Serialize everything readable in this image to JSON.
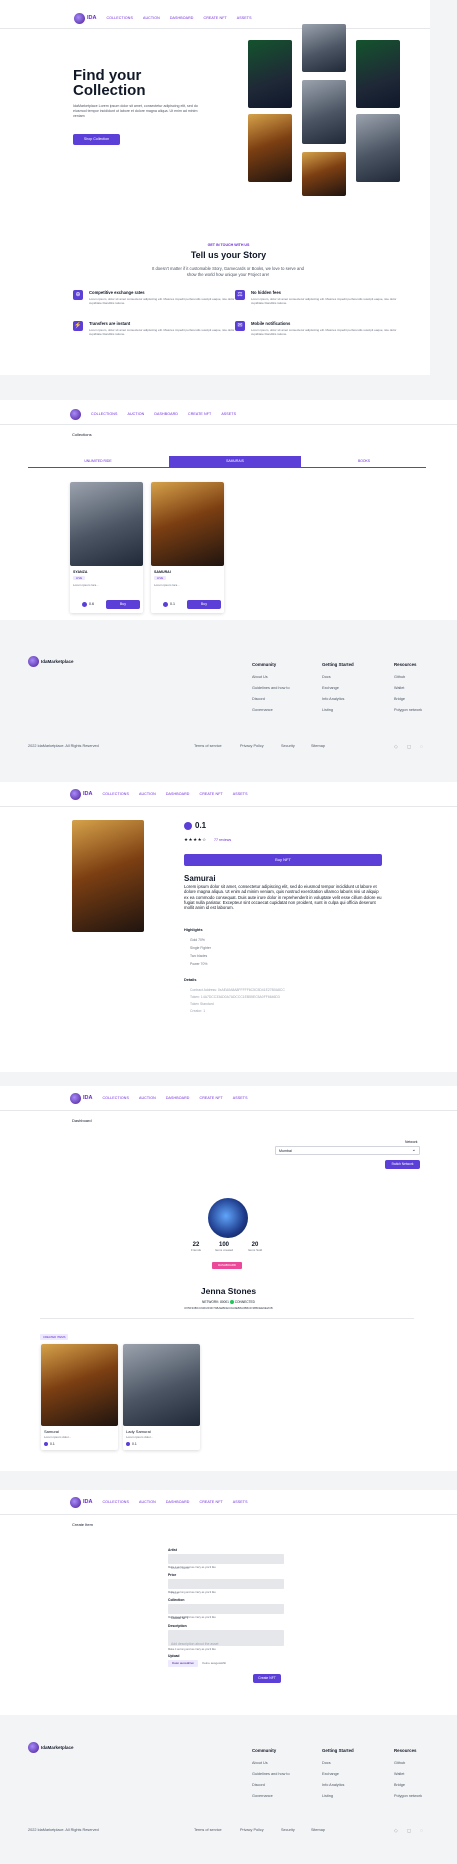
{
  "brand": {
    "logo_text": "IDA",
    "footer_name": "IdaMarketplace"
  },
  "nav": {
    "links": [
      "COLLECTIONS",
      "AUCTION",
      "DASHBOARD",
      "CREATE NFT",
      "ASSETS"
    ]
  },
  "hero": {
    "title_line1": "Find your",
    "title_line2": "Collection",
    "description": "IdaMarketplace Lorem ipsum dolor sit amet, consectetur adipiscing elit, sed do eiusmod tempor incididunt ut labore et dolore magna aliqua. Ut enim ad minim veniam",
    "button": "Shop Collection"
  },
  "story": {
    "eyebrow": "GET IN TOUCH WITH US",
    "title": "Tell us your Story",
    "subtitle": "It doesn't matter if it customable Story, Gamecards or Books, we love to serve and show the world how unique your Project are!",
    "features": [
      {
        "title": "Competitive exchange rates",
        "text": "Lorem ipsum, dolor sit amet consectetur adipisicing elit. Maiores impedit perferendis suscipit eaque, iste dolor cupiditate blanditiis ratione."
      },
      {
        "title": "No hidden fees",
        "text": "Lorem ipsum, dolor sit amet consectetur adipisicing elit. Maiores impedit perferendis suscipit eaque, iste dolor cupiditate blanditiis ratione."
      },
      {
        "title": "Transfers are instant",
        "text": "Lorem ipsum, dolor sit amet consectetur adipisicing elit. Maiores impedit perferendis suscipit eaque, iste dolor cupiditate blanditiis ratione."
      },
      {
        "title": "Mobile notifications",
        "text": "Lorem ipsum, dolor sit amet consectetur adipisicing elit. Maiores impedit perferendis suscipit eaque, iste dolor cupiditate blanditiis ratione."
      }
    ]
  },
  "collections": {
    "heading": "Collections",
    "tabs": [
      "UNLIMITED RIDE",
      "SAMURAIS",
      "BOOKS"
    ],
    "active_tab": 1,
    "cards": [
      {
        "name": "SYANZA",
        "badge": "LIVE",
        "desc": "Lorem ipsum lora...",
        "price": "0.6",
        "buy": "Buy"
      },
      {
        "name": "SAMURAI",
        "badge": "LIVE",
        "desc": "Lorem ipsum lora...",
        "price": "0.1",
        "buy": "Buy"
      }
    ]
  },
  "footer": {
    "columns": [
      {
        "title": "Community",
        "links": [
          "About Us",
          "Guidelines and how to",
          "Discord",
          "Governance"
        ]
      },
      {
        "title": "Getting Started",
        "links": [
          "Docs",
          "Exchange",
          "Info Analytics",
          "Listing"
        ]
      },
      {
        "title": "Resources",
        "links": [
          "Github",
          "Wallet",
          "Bridge",
          "Polygon network"
        ]
      }
    ],
    "copyright": "2022 IdaMarketplace. All Rights Reserved",
    "bottom_links": [
      "Terms of service",
      "Privacy Policy",
      "Security",
      "Sitemap"
    ]
  },
  "detail": {
    "price": "0.1",
    "reviews": "77 reviews",
    "buy_button": "Buy NFT",
    "title": "Samurai",
    "description": "Lorem ipsum dolor sit amet, consectetur adipiscing elit, sed do eiusmod tempor incididunt ut labore et dolore magna aliqua. Ut enim ad minim veniam, quis nostrud exercitation ullamco laboris nisi ut aliquip ex ea commodo consequat. Duis aute irure dolor in reprehenderit in voluptate velit esse cillum dolore eu fugiat nulla pariatur. Excepteur sint occaecat cupidatat non proident, sunt in culpa qui officia deserunt mollit anim id est laborum.",
    "highlights_title": "Highlights",
    "highlights": [
      "Gold 70%",
      "Single Fighter",
      "Two blades",
      "Power 70%"
    ],
    "details_title": "Details",
    "details": [
      "Contract Address: 0xAEA0A8A8FFFFF6C5C5D41E27B0A8CC",
      "Token: 14A7DCC33AD0A7ADCCC1EB55EC5A0FF6646D3",
      "Token Standard",
      "Creator: 1"
    ]
  },
  "dashboard": {
    "heading": "Dashboard",
    "network_label": "Network",
    "network_value": "Mumbai",
    "switch_button": "Switch Network",
    "stats": [
      {
        "value": "22",
        "label": "Friends"
      },
      {
        "value": "100",
        "label": "Items created"
      },
      {
        "value": "20",
        "label": "Items Sold"
      }
    ],
    "role_badge": "DASHBOARD",
    "name": "Jenna Stones",
    "network_status": "NETWORK: 80001",
    "connected_label": "CONNECTED",
    "address": "0X5F33BCC93F2F0F798AEBFEC0A3E88A3B6CF385FEE9E2CB",
    "section_badge": "CREATED ITEMS",
    "items": [
      {
        "name": "Samurai",
        "desc": "Lorem ipsum dolor...",
        "price": "0.1"
      },
      {
        "name": "Lady Samurai",
        "desc": "Lorem ipsum dolor...",
        "price": "0.1"
      }
    ]
  },
  "create": {
    "heading": "Create Item",
    "fields": [
      {
        "label": "Artist",
        "placeholder": "Asset Name",
        "help": "Make it as long and as crazy as you'd like"
      },
      {
        "label": "Price",
        "placeholder": "Price",
        "help": "Make it as long and as crazy as you'd like"
      },
      {
        "label": "Collection",
        "placeholder": "Global NFT",
        "help": "Make it as long and as crazy as you'd like"
      },
      {
        "label": "Description",
        "placeholder": "Add description about the asset",
        "help": "Make it as long and as crazy as you'd like"
      }
    ],
    "upload_label": "Upload",
    "choose_button": "Datei auswählen",
    "no_file": "Keine ausgewählt",
    "submit": "Create NFT"
  },
  "colors": {
    "accent": "#5b3fd6",
    "accent_text": "#6d28d9",
    "badge_pink": "#ec4899"
  }
}
